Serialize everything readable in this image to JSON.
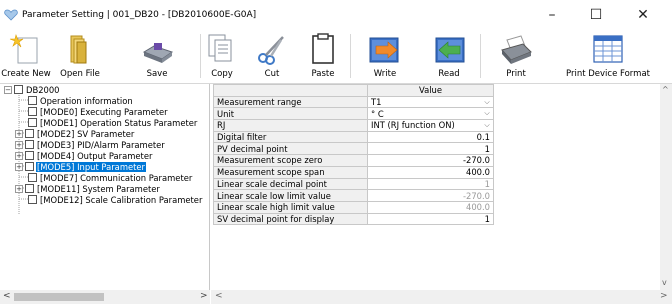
{
  "window": {
    "title": "Parameter Setting | 001_DB20 - [DB2010600E-G0A]",
    "minimize": "–",
    "maximize": "☐",
    "close": "✕"
  },
  "toolbar": {
    "create_new": "Create New",
    "open_file": "Open File",
    "save": "Save",
    "copy": "Copy",
    "cut": "Cut",
    "paste": "Paste",
    "write": "Write",
    "read": "Read",
    "print": "Print",
    "print_device_format": "Print Device Format",
    "overflow": "»"
  },
  "tree": {
    "root": "DB2000",
    "items": [
      "Operation information",
      "[MODE0] Executing Parameter",
      "[MODE1] Operation Status Parameter",
      "[MODE2] SV Parameter",
      "[MODE3] PID/Alarm Parameter",
      "[MODE4] Output Parameter",
      "[MODE5] Input Parameter",
      "[MODE7] Communication Parameter",
      "[MODE11] System Parameter",
      "[MODE12] Scale Calibration Parameter"
    ],
    "scroll_left": "<",
    "scroll_right": ">"
  },
  "grid": {
    "header_value": "Value",
    "rows": [
      {
        "name": "Measurement range",
        "value": "T1"
      },
      {
        "name": "Unit",
        "value": "° C"
      },
      {
        "name": "RJ",
        "value": "INT (RJ function ON)"
      },
      {
        "name": "Digital filter",
        "value": "0.1"
      },
      {
        "name": "PV decimal point",
        "value": "1"
      },
      {
        "name": "Measurement scope zero",
        "value": "-270.0"
      },
      {
        "name": "Measurement scope span",
        "value": "400.0"
      },
      {
        "name": "Linear scale decimal point",
        "value": "1"
      },
      {
        "name": "Linear scale low limit value",
        "value": "-270.0"
      },
      {
        "name": "Linear scale high limit value",
        "value": "400.0"
      },
      {
        "name": "SV decimal point for display",
        "value": "1"
      }
    ],
    "dropdown_arrow": "⌵",
    "scroll_up": "^",
    "scroll_down": "v",
    "scroll_left": "<",
    "scroll_right": ">"
  }
}
